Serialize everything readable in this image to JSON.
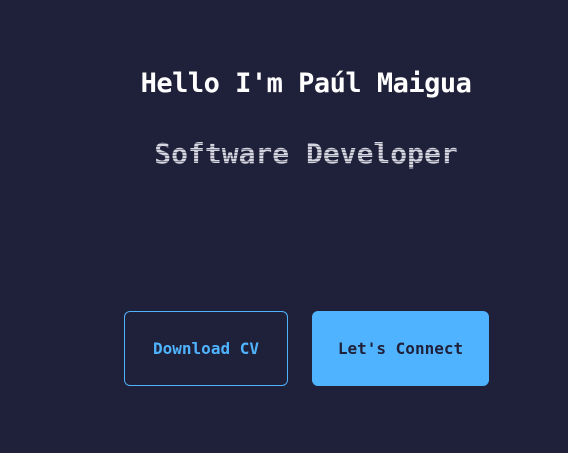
{
  "hero": {
    "title": "Hello I'm Paúl Maigua",
    "subtitle": "Software Developer",
    "buttons": {
      "download_label": "Download CV",
      "connect_label": "Let's Connect"
    }
  },
  "colors": {
    "background": "#1f2039",
    "accent": "#4fb3ff",
    "title": "#ffffff",
    "subtitle": "#b8b9c8"
  }
}
